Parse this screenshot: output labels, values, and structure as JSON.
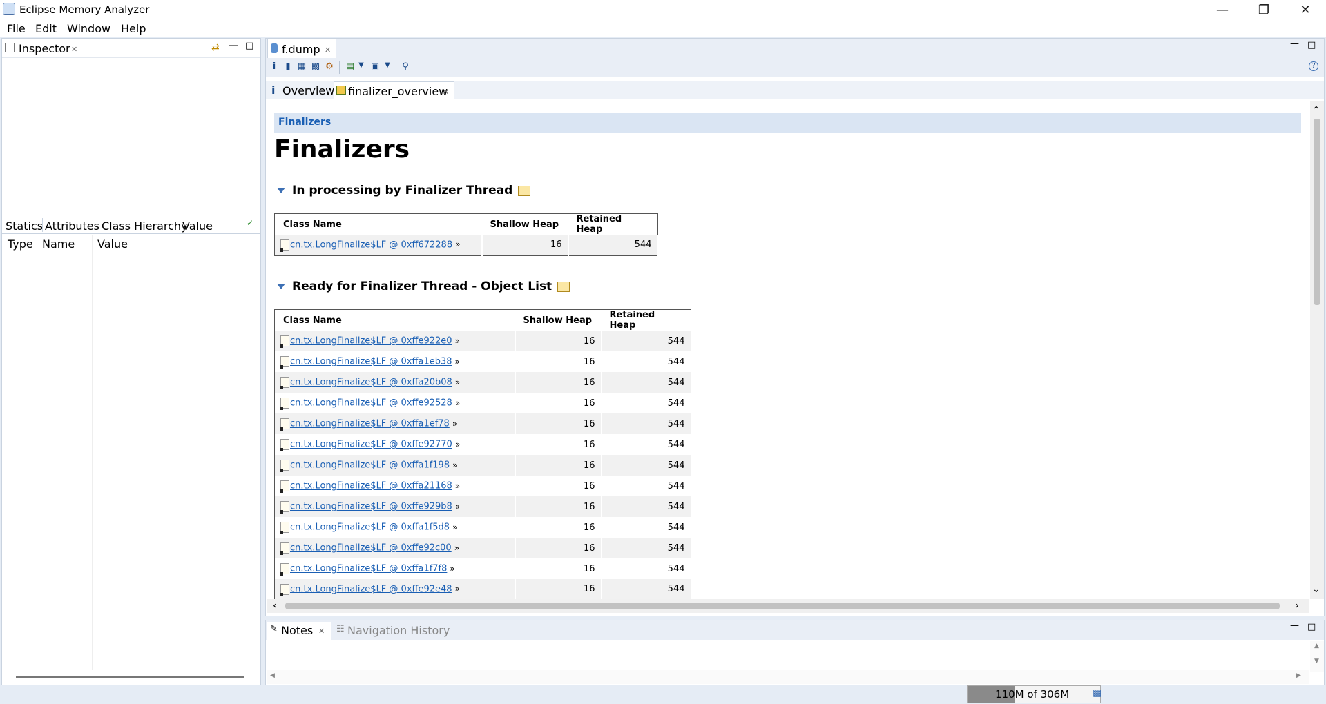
{
  "window": {
    "title": "Eclipse Memory Analyzer"
  },
  "menu": [
    "File",
    "Edit",
    "Window",
    "Help"
  ],
  "inspector": {
    "tab_label": "Inspector",
    "sub_tabs": [
      "Statics",
      "Attributes",
      "Class Hierarchy",
      "Value"
    ],
    "columns": [
      "Type",
      "Name",
      "Value"
    ]
  },
  "editor": {
    "tab_label": "f.dump",
    "sub_tabs": [
      "Overview",
      "finalizer_overview"
    ]
  },
  "page": {
    "breadcrumb": "Finalizers",
    "title": "Finalizers",
    "section1": {
      "title": "In processing by Finalizer Thread",
      "headers": [
        "Class Name",
        "Shallow Heap",
        "Retained Heap"
      ],
      "rows": [
        {
          "name": "cn.tx.LongFinalize$LF @ 0xff672288",
          "shallow": "16",
          "retained": "544"
        }
      ]
    },
    "section2": {
      "title": "Ready for Finalizer Thread - Object List",
      "headers": [
        "Class Name",
        "Shallow Heap",
        "Retained Heap"
      ],
      "rows": [
        {
          "name": "cn.tx.LongFinalize$LF @ 0xffe922e0",
          "shallow": "16",
          "retained": "544"
        },
        {
          "name": "cn.tx.LongFinalize$LF @ 0xffa1eb38",
          "shallow": "16",
          "retained": "544"
        },
        {
          "name": "cn.tx.LongFinalize$LF @ 0xffa20b08",
          "shallow": "16",
          "retained": "544"
        },
        {
          "name": "cn.tx.LongFinalize$LF @ 0xffe92528",
          "shallow": "16",
          "retained": "544"
        },
        {
          "name": "cn.tx.LongFinalize$LF @ 0xffa1ef78",
          "shallow": "16",
          "retained": "544"
        },
        {
          "name": "cn.tx.LongFinalize$LF @ 0xffe92770",
          "shallow": "16",
          "retained": "544"
        },
        {
          "name": "cn.tx.LongFinalize$LF @ 0xffa1f198",
          "shallow": "16",
          "retained": "544"
        },
        {
          "name": "cn.tx.LongFinalize$LF @ 0xffa21168",
          "shallow": "16",
          "retained": "544"
        },
        {
          "name": "cn.tx.LongFinalize$LF @ 0xffe929b8",
          "shallow": "16",
          "retained": "544"
        },
        {
          "name": "cn.tx.LongFinalize$LF @ 0xffa1f5d8",
          "shallow": "16",
          "retained": "544"
        },
        {
          "name": "cn.tx.LongFinalize$LF @ 0xffe92c00",
          "shallow": "16",
          "retained": "544"
        },
        {
          "name": "cn.tx.LongFinalize$LF @ 0xffa1f7f8",
          "shallow": "16",
          "retained": "544"
        },
        {
          "name": "cn.tx.LongFinalize$LF @ 0xffe92e48",
          "shallow": "16",
          "retained": "544"
        }
      ]
    }
  },
  "bottom": {
    "tabs": [
      "Notes",
      "Navigation History"
    ]
  },
  "status": {
    "heap": "110M of 306M",
    "heap_used_fraction": 0.36
  }
}
